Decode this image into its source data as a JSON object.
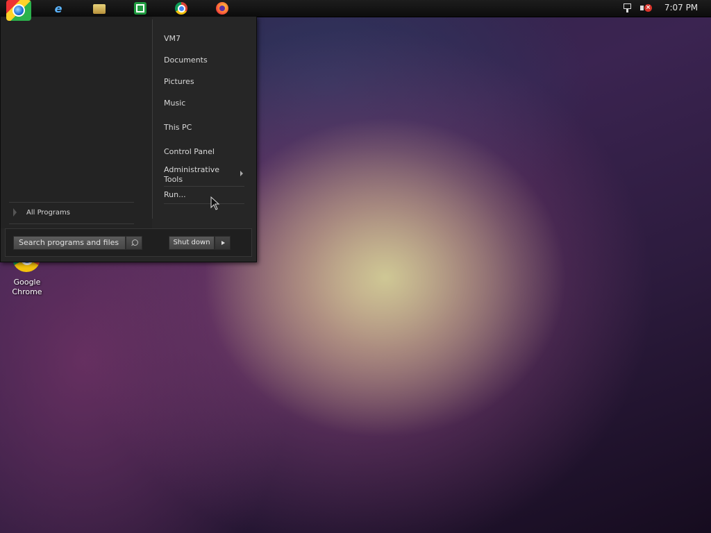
{
  "taskbar": {
    "pinned": [
      {
        "name": "Internet Explorer",
        "icon": "internet-explorer-icon"
      },
      {
        "name": "File Explorer",
        "icon": "file-explorer-icon"
      },
      {
        "name": "Store",
        "icon": "store-icon"
      },
      {
        "name": "Google Chrome",
        "icon": "chrome-icon"
      },
      {
        "name": "Firefox",
        "icon": "firefox-icon"
      }
    ],
    "tray": {
      "network_icon": "network-icon",
      "volume_icon": "volume-muted-icon",
      "clock": "7:07 PM"
    }
  },
  "start_menu": {
    "all_programs_label": "All Programs",
    "right_items": [
      "VM7",
      "Documents",
      "Pictures",
      "Music",
      "This PC",
      "Control Panel",
      "Administrative Tools",
      "Run..."
    ],
    "search_placeholder": "Search programs and files",
    "shutdown_label": "Shut down"
  },
  "desktop": {
    "icons": [
      {
        "label": "Google Chrome",
        "icon": "chrome-icon"
      }
    ]
  },
  "colors": {
    "menu_bg": "#262626",
    "taskbar_bg": "#0c0c0c",
    "text": "#d9d9d9"
  }
}
